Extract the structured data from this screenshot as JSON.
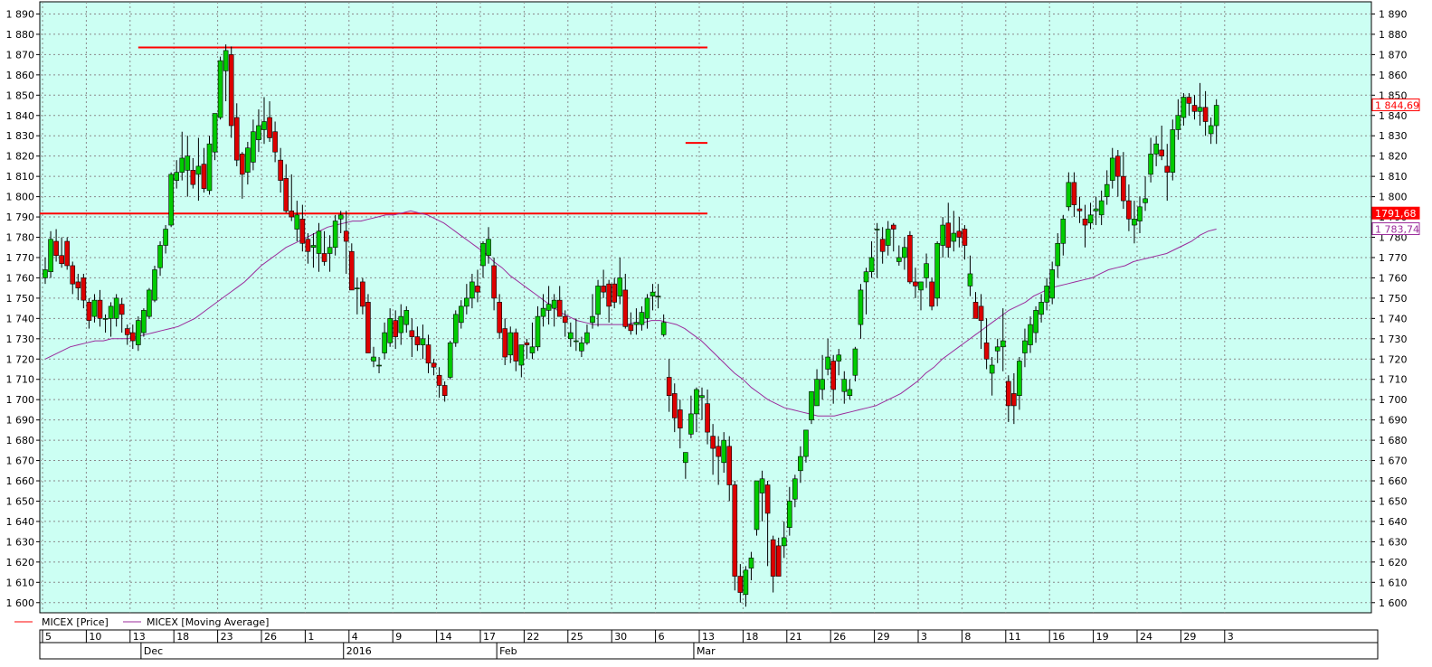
{
  "chart_data": {
    "type": "candlestick",
    "ylim": [
      1595,
      1896
    ],
    "y_ticks": [
      1600,
      1610,
      1620,
      1630,
      1640,
      1650,
      1660,
      1670,
      1680,
      1690,
      1700,
      1710,
      1720,
      1730,
      1740,
      1750,
      1760,
      1770,
      1780,
      1790,
      1800,
      1810,
      1820,
      1830,
      1840,
      1850,
      1860,
      1870,
      1880,
      1890
    ],
    "y_tick_labels": [
      "1 600",
      "1 610",
      "1 620",
      "1 630",
      "1 640",
      "1 650",
      "1 660",
      "1 670",
      "1 680",
      "1 690",
      "1 700",
      "1 710",
      "1 720",
      "1 730",
      "1 740",
      "1 750",
      "1 760",
      "1 770",
      "1 780",
      "1 790",
      "1 800",
      "1 810",
      "1 820",
      "1 830",
      "1 840",
      "1 850",
      "1 860",
      "1 870",
      "1 880",
      "1 890"
    ],
    "x_day_labels": [
      "5",
      "10",
      "13",
      "18",
      "23",
      "26",
      "1",
      "4",
      "9",
      "14",
      "17",
      "22",
      "25",
      "30",
      "6",
      "13",
      "18",
      "21",
      "26",
      "29",
      "3",
      "8",
      "11",
      "16",
      "19",
      "24",
      "29",
      "3"
    ],
    "x_period_labels": [
      {
        "text": "Dec",
        "bar_index": 18
      },
      {
        "text": "2016",
        "bar_index": 55
      },
      {
        "text": "Feb",
        "bar_index": 83
      },
      {
        "text": "Mar",
        "bar_index": 119
      }
    ],
    "grid": true,
    "legend_position": "bottom-left",
    "series": [
      {
        "name": "MICEX [Price]",
        "color": "#ff0000"
      },
      {
        "name": "MICEX [Moving Average]",
        "color": "#9b2b9b"
      }
    ],
    "last_price_label": "1 844,69",
    "last_ma_label": "1 783,74",
    "level_label": "1791,68",
    "horizontal_levels": [
      {
        "value": 1873.5,
        "from_bar": 17,
        "to_bar": 121
      },
      {
        "value": 1791.7,
        "from_bar": 0,
        "to_bar": 121
      },
      {
        "value": 1826.5,
        "from_bar": 117,
        "to_bar": 121
      }
    ],
    "ohlc": [
      [
        1760,
        1770,
        1757,
        1764
      ],
      [
        1763,
        1783,
        1760,
        1779
      ],
      [
        1778,
        1784,
        1768,
        1771
      ],
      [
        1771,
        1780,
        1765,
        1767
      ],
      [
        1778,
        1780,
        1764,
        1766
      ],
      [
        1766,
        1768,
        1752,
        1757
      ],
      [
        1758,
        1762,
        1749,
        1755
      ],
      [
        1760,
        1762,
        1745,
        1749
      ],
      [
        1748,
        1750,
        1735,
        1739
      ],
      [
        1741,
        1752,
        1738,
        1749
      ],
      [
        1749,
        1754,
        1736,
        1740
      ],
      [
        1740,
        1742,
        1733,
        1740
      ],
      [
        1740,
        1748,
        1731,
        1746
      ],
      [
        1740,
        1752,
        1736,
        1750
      ],
      [
        1747,
        1750,
        1733,
        1742
      ],
      [
        1735,
        1737,
        1727,
        1732
      ],
      [
        1733,
        1737,
        1725,
        1729
      ],
      [
        1727,
        1741,
        1724,
        1739
      ],
      [
        1733,
        1745,
        1731,
        1744
      ],
      [
        1741,
        1755,
        1740,
        1754
      ],
      [
        1749,
        1766,
        1748,
        1764
      ],
      [
        1765,
        1778,
        1761,
        1776
      ],
      [
        1776,
        1786,
        1772,
        1784
      ],
      [
        1786,
        1812,
        1785,
        1811
      ],
      [
        1808,
        1818,
        1804,
        1812
      ],
      [
        1812,
        1832,
        1808,
        1819
      ],
      [
        1813,
        1830,
        1800,
        1820
      ],
      [
        1813,
        1819,
        1804,
        1806
      ],
      [
        1811,
        1829,
        1798,
        1815
      ],
      [
        1816,
        1824,
        1802,
        1804
      ],
      [
        1803,
        1830,
        1801,
        1826
      ],
      [
        1822,
        1841,
        1818,
        1841
      ],
      [
        1839,
        1869,
        1838,
        1867
      ],
      [
        1862,
        1875,
        1847,
        1872
      ],
      [
        1870,
        1874,
        1829,
        1835
      ],
      [
        1839,
        1846,
        1815,
        1818
      ],
      [
        1821,
        1822,
        1799,
        1811
      ],
      [
        1812,
        1827,
        1806,
        1824
      ],
      [
        1817,
        1838,
        1813,
        1832
      ],
      [
        1828,
        1843,
        1822,
        1835
      ],
      [
        1833,
        1849,
        1826,
        1837
      ],
      [
        1839,
        1847,
        1827,
        1829
      ],
      [
        1832,
        1837,
        1817,
        1822
      ],
      [
        1818,
        1824,
        1802,
        1808
      ],
      [
        1809,
        1816,
        1792,
        1793
      ],
      [
        1793,
        1811,
        1788,
        1790
      ],
      [
        1784,
        1798,
        1778,
        1791
      ],
      [
        1789,
        1796,
        1773,
        1777
      ],
      [
        1779,
        1782,
        1767,
        1773
      ],
      [
        1775,
        1782,
        1765,
        1776
      ],
      [
        1772,
        1787,
        1763,
        1783
      ],
      [
        1772,
        1783,
        1766,
        1768
      ],
      [
        1772,
        1781,
        1763,
        1775
      ],
      [
        1775,
        1791,
        1771,
        1788
      ],
      [
        1789,
        1793,
        1782,
        1791
      ],
      [
        1783,
        1793,
        1762,
        1778
      ],
      [
        1773,
        1777,
        1754,
        1754
      ],
      [
        1755,
        1760,
        1742,
        1755
      ],
      [
        1758,
        1760,
        1742,
        1746
      ],
      [
        1748,
        1752,
        1723,
        1723
      ],
      [
        1719,
        1726,
        1716,
        1721
      ],
      [
        1717,
        1721,
        1713,
        1717
      ],
      [
        1723,
        1738,
        1720,
        1733
      ],
      [
        1728,
        1745,
        1726,
        1740
      ],
      [
        1739,
        1744,
        1725,
        1731
      ],
      [
        1733,
        1747,
        1727,
        1741
      ],
      [
        1737,
        1746,
        1733,
        1744
      ],
      [
        1734,
        1740,
        1721,
        1731
      ],
      [
        1731,
        1736,
        1724,
        1727
      ],
      [
        1727,
        1737,
        1720,
        1730
      ],
      [
        1727,
        1732,
        1713,
        1718
      ],
      [
        1718,
        1720,
        1712,
        1716
      ],
      [
        1712,
        1716,
        1701,
        1707
      ],
      [
        1707,
        1709,
        1699,
        1702
      ],
      [
        1711,
        1729,
        1710,
        1728
      ],
      [
        1728,
        1744,
        1726,
        1742
      ],
      [
        1738,
        1749,
        1735,
        1746
      ],
      [
        1746,
        1757,
        1742,
        1750
      ],
      [
        1750,
        1762,
        1745,
        1758
      ],
      [
        1756,
        1764,
        1748,
        1753
      ],
      [
        1766,
        1778,
        1760,
        1777
      ],
      [
        1771,
        1785,
        1767,
        1779
      ],
      [
        1766,
        1770,
        1744,
        1750
      ],
      [
        1748,
        1752,
        1730,
        1733
      ],
      [
        1735,
        1740,
        1717,
        1721
      ],
      [
        1722,
        1736,
        1718,
        1733
      ],
      [
        1733,
        1735,
        1714,
        1719
      ],
      [
        1717,
        1725,
        1711,
        1727
      ],
      [
        1728,
        1730,
        1720,
        1727
      ],
      [
        1723,
        1738,
        1720,
        1726
      ],
      [
        1726,
        1746,
        1724,
        1741
      ],
      [
        1741,
        1752,
        1736,
        1745
      ],
      [
        1744,
        1756,
        1737,
        1747
      ],
      [
        1745,
        1752,
        1736,
        1749
      ],
      [
        1749,
        1756,
        1742,
        1741
      ],
      [
        1741,
        1744,
        1731,
        1738
      ],
      [
        1730,
        1738,
        1726,
        1733
      ],
      [
        1729,
        1740,
        1724,
        1729
      ],
      [
        1724,
        1731,
        1721,
        1728
      ],
      [
        1728,
        1737,
        1727,
        1733
      ],
      [
        1738,
        1752,
        1735,
        1741
      ],
      [
        1742,
        1759,
        1736,
        1756
      ],
      [
        1756,
        1764,
        1750,
        1753
      ],
      [
        1757,
        1759,
        1738,
        1746
      ],
      [
        1757,
        1760,
        1745,
        1748
      ],
      [
        1751,
        1770,
        1747,
        1760
      ],
      [
        1754,
        1762,
        1735,
        1736
      ],
      [
        1737,
        1743,
        1732,
        1734
      ],
      [
        1737,
        1745,
        1732,
        1738
      ],
      [
        1737,
        1746,
        1734,
        1743
      ],
      [
        1740,
        1752,
        1735,
        1750
      ],
      [
        1751,
        1757,
        1744,
        1753
      ],
      [
        1751,
        1757,
        1745,
        1751
      ],
      [
        1732,
        1742,
        1731,
        1738
      ],
      [
        1711,
        1720,
        1694,
        1702
      ],
      [
        1703,
        1708,
        1684,
        1691
      ],
      [
        1695,
        1700,
        1676,
        1686
      ],
      [
        1669,
        1674,
        1661,
        1674
      ],
      [
        1683,
        1702,
        1681,
        1693
      ],
      [
        1693,
        1706,
        1684,
        1705
      ],
      [
        1701,
        1706,
        1690,
        1702
      ],
      [
        1698,
        1705,
        1678,
        1684
      ],
      [
        1682,
        1688,
        1663,
        1676
      ],
      [
        1677,
        1682,
        1658,
        1672
      ],
      [
        1669,
        1684,
        1664,
        1680
      ],
      [
        1677,
        1682,
        1650,
        1658
      ],
      [
        1658,
        1660,
        1606,
        1613
      ],
      [
        1613,
        1619,
        1600,
        1605
      ],
      [
        1604,
        1618,
        1598,
        1616
      ],
      [
        1617,
        1625,
        1611,
        1622
      ],
      [
        1636,
        1660,
        1633,
        1660
      ],
      [
        1654,
        1665,
        1640,
        1661
      ],
      [
        1658,
        1660,
        1618,
        1644
      ],
      [
        1631,
        1633,
        1605,
        1613
      ],
      [
        1628,
        1632,
        1613,
        1613
      ],
      [
        1628,
        1640,
        1622,
        1632
      ],
      [
        1637,
        1657,
        1633,
        1650
      ],
      [
        1651,
        1663,
        1647,
        1661
      ],
      [
        1665,
        1677,
        1659,
        1672
      ],
      [
        1672,
        1685,
        1669,
        1685
      ],
      [
        1690,
        1704,
        1688,
        1704
      ],
      [
        1697,
        1715,
        1697,
        1710
      ],
      [
        1705,
        1722,
        1700,
        1710
      ],
      [
        1715,
        1730,
        1712,
        1721
      ],
      [
        1719,
        1722,
        1698,
        1705
      ],
      [
        1719,
        1725,
        1712,
        1722
      ],
      [
        1704,
        1714,
        1698,
        1710
      ],
      [
        1702,
        1710,
        1700,
        1705
      ],
      [
        1712,
        1726,
        1709,
        1725
      ],
      [
        1737,
        1757,
        1730,
        1754
      ],
      [
        1758,
        1765,
        1742,
        1763
      ],
      [
        1763,
        1778,
        1760,
        1770
      ],
      [
        1784,
        1787,
        1760,
        1784
      ],
      [
        1779,
        1785,
        1767,
        1773
      ],
      [
        1776,
        1788,
        1771,
        1784
      ],
      [
        1786,
        1787,
        1773,
        1784
      ],
      [
        1768,
        1776,
        1766,
        1770
      ],
      [
        1770,
        1780,
        1764,
        1775
      ],
      [
        1781,
        1783,
        1757,
        1758
      ],
      [
        1758,
        1765,
        1750,
        1756
      ],
      [
        1754,
        1757,
        1744,
        1758
      ],
      [
        1760,
        1772,
        1755,
        1767
      ],
      [
        1758,
        1760,
        1744,
        1746
      ],
      [
        1750,
        1778,
        1746,
        1777
      ],
      [
        1776,
        1790,
        1770,
        1786
      ],
      [
        1787,
        1797,
        1770,
        1775
      ],
      [
        1778,
        1793,
        1773,
        1782
      ],
      [
        1783,
        1790,
        1775,
        1780
      ],
      [
        1784,
        1786,
        1769,
        1776
      ],
      [
        1756,
        1771,
        1751,
        1762
      ],
      [
        1748,
        1753,
        1740,
        1740
      ],
      [
        1746,
        1752,
        1725,
        1739
      ],
      [
        1728,
        1740,
        1715,
        1720
      ],
      [
        1713,
        1721,
        1702,
        1717
      ],
      [
        1724,
        1730,
        1718,
        1726
      ],
      [
        1726,
        1745,
        1714,
        1729
      ],
      [
        1709,
        1712,
        1689,
        1697
      ],
      [
        1703,
        1713,
        1688,
        1697
      ],
      [
        1702,
        1721,
        1695,
        1719
      ],
      [
        1723,
        1735,
        1716,
        1729
      ],
      [
        1727,
        1741,
        1723,
        1737
      ],
      [
        1733,
        1746,
        1728,
        1744
      ],
      [
        1742,
        1752,
        1738,
        1748
      ],
      [
        1748,
        1760,
        1744,
        1756
      ],
      [
        1750,
        1768,
        1747,
        1764
      ],
      [
        1766,
        1782,
        1760,
        1777
      ],
      [
        1777,
        1791,
        1771,
        1789
      ],
      [
        1795,
        1812,
        1793,
        1807
      ],
      [
        1807,
        1812,
        1790,
        1796
      ],
      [
        1794,
        1800,
        1787,
        1793
      ],
      [
        1789,
        1796,
        1775,
        1786
      ],
      [
        1787,
        1797,
        1784,
        1791
      ],
      [
        1793,
        1800,
        1786,
        1794
      ],
      [
        1791,
        1803,
        1786,
        1798
      ],
      [
        1800,
        1813,
        1796,
        1806
      ],
      [
        1808,
        1824,
        1804,
        1819
      ],
      [
        1820,
        1823,
        1800,
        1810
      ],
      [
        1810,
        1822,
        1794,
        1798
      ],
      [
        1798,
        1806,
        1783,
        1789
      ],
      [
        1786,
        1798,
        1777,
        1789
      ],
      [
        1788,
        1800,
        1782,
        1795
      ],
      [
        1797,
        1810,
        1793,
        1799
      ],
      [
        1811,
        1829,
        1807,
        1821
      ],
      [
        1821,
        1830,
        1815,
        1826
      ],
      [
        1823,
        1835,
        1818,
        1820
      ],
      [
        1815,
        1826,
        1798,
        1812
      ],
      [
        1812,
        1838,
        1808,
        1833
      ],
      [
        1833,
        1848,
        1828,
        1840
      ],
      [
        1839,
        1851,
        1835,
        1849
      ],
      [
        1849,
        1851,
        1840,
        1846
      ],
      [
        1845,
        1850,
        1838,
        1842
      ],
      [
        1842,
        1856,
        1835,
        1844
      ],
      [
        1844,
        1852,
        1830,
        1837
      ],
      [
        1831,
        1839,
        1826,
        1835
      ],
      [
        1835,
        1848,
        1826,
        1845
      ]
    ],
    "ma": [
      1720,
      1722,
      1724,
      1726,
      1727,
      1728,
      1729,
      1729,
      1730,
      1730,
      1730,
      1731,
      1732,
      1733,
      1734,
      1735,
      1736,
      1738,
      1740,
      1743,
      1746,
      1749,
      1752,
      1755,
      1758,
      1762,
      1766,
      1769,
      1772,
      1775,
      1777,
      1779,
      1781,
      1783,
      1785,
      1786,
      1787,
      1788,
      1788,
      1789,
      1790,
      1791,
      1791,
      1792,
      1793,
      1792,
      1791,
      1789,
      1787,
      1784,
      1781,
      1778,
      1775,
      1772,
      1768,
      1765,
      1761,
      1758,
      1755,
      1752,
      1749,
      1746,
      1743,
      1741,
      1739,
      1738,
      1737,
      1737,
      1737,
      1737,
      1737,
      1738,
      1738,
      1739,
      1739,
      1738,
      1737,
      1735,
      1732,
      1729,
      1725,
      1721,
      1717,
      1713,
      1710,
      1706,
      1703,
      1700,
      1698,
      1696,
      1695,
      1694,
      1693,
      1692,
      1692,
      1692,
      1693,
      1694,
      1695,
      1696,
      1697,
      1699,
      1701,
      1703,
      1706,
      1709,
      1713,
      1716,
      1720,
      1723,
      1726,
      1729,
      1732,
      1735,
      1738,
      1741,
      1744,
      1746,
      1748,
      1751,
      1753,
      1755,
      1756,
      1757,
      1758,
      1759,
      1760,
      1762,
      1764,
      1765,
      1766,
      1768,
      1769,
      1770,
      1771,
      1772,
      1774,
      1776,
      1778,
      1781,
      1783,
      1784
    ]
  }
}
